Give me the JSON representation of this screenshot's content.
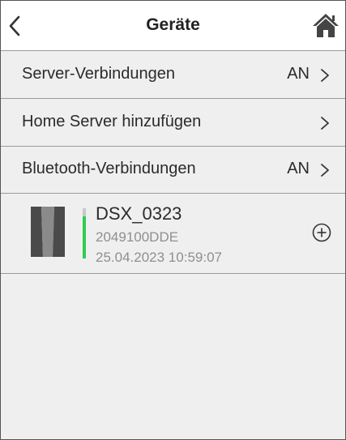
{
  "header": {
    "title": "Geräte",
    "back_icon": "chevron-left-icon",
    "home_icon": "home-icon"
  },
  "settings": [
    {
      "label": "Server-Verbindungen",
      "value": "AN"
    },
    {
      "label": "Home Server hinzufügen",
      "value": ""
    },
    {
      "label": "Bluetooth-Verbindungen",
      "value": "AN"
    }
  ],
  "device": {
    "name": "DSX_0323",
    "serial": "2049100DDE",
    "timestamp": "25.04.2023 10:59:07",
    "add_icon": "plus-circle-icon",
    "signal_color": "#2ecc55"
  }
}
